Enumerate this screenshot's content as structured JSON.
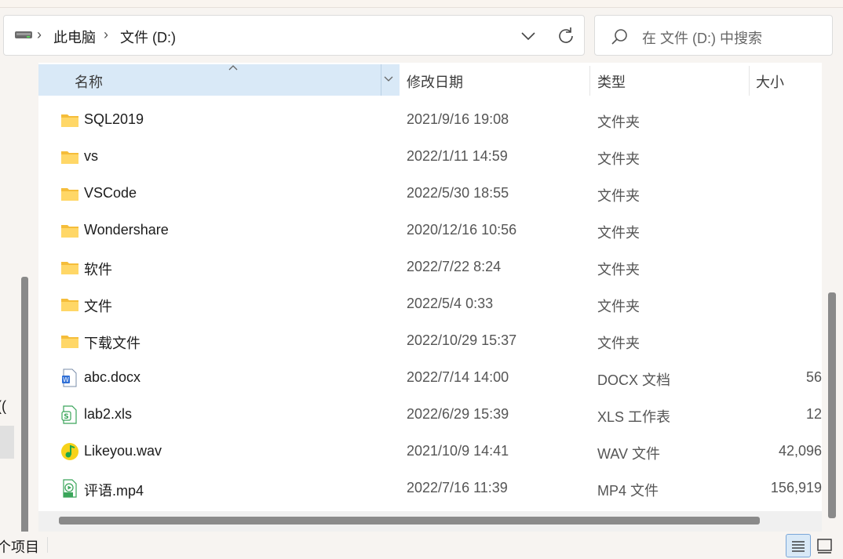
{
  "breadcrumb": {
    "items": [
      "此电脑",
      "文件 (D:)"
    ]
  },
  "search": {
    "placeholder": "在 文件 (D:) 中搜索"
  },
  "columns": {
    "name": "名称",
    "modified": "修改日期",
    "type": "类型",
    "size": "大小"
  },
  "files": [
    {
      "name": "SQL2019",
      "modified": "2021/9/16 19:08",
      "type": "文件夹",
      "size": "",
      "icon": "folder-icon"
    },
    {
      "name": "vs",
      "modified": "2022/1/11 14:59",
      "type": "文件夹",
      "size": "",
      "icon": "folder-icon"
    },
    {
      "name": "VSCode",
      "modified": "2022/5/30 18:55",
      "type": "文件夹",
      "size": "",
      "icon": "folder-icon"
    },
    {
      "name": "Wondershare",
      "modified": "2020/12/16 10:56",
      "type": "文件夹",
      "size": "",
      "icon": "folder-icon"
    },
    {
      "name": "软件",
      "modified": "2022/7/22 8:24",
      "type": "文件夹",
      "size": "",
      "icon": "folder-icon"
    },
    {
      "name": "文件",
      "modified": "2022/5/4 0:33",
      "type": "文件夹",
      "size": "",
      "icon": "folder-icon"
    },
    {
      "name": "下载文件",
      "modified": "2022/10/29 15:37",
      "type": "文件夹",
      "size": "",
      "icon": "folder-icon"
    },
    {
      "name": "abc.docx",
      "modified": "2022/7/14 14:00",
      "type": "DOCX 文档",
      "size": "56",
      "icon": "word-document-icon"
    },
    {
      "name": "lab2.xls",
      "modified": "2022/6/29 15:39",
      "type": "XLS 工作表",
      "size": "12",
      "icon": "spreadsheet-icon"
    },
    {
      "name": "Likeyou.wav",
      "modified": "2021/10/9 14:41",
      "type": "WAV 文件",
      "size": "42,096",
      "icon": "music-icon"
    },
    {
      "name": "评语.mp4",
      "modified": "2022/7/16 11:39",
      "type": "MP4 文件",
      "size": "156,919",
      "icon": "video-icon"
    }
  ],
  "navpane": {
    "partial_label": "(("
  },
  "status": {
    "items_text": "个项目"
  },
  "colors": {
    "header_selected": "#d9e9f7",
    "folder": "#f7c74d",
    "scrollbar": "#8a8a8a"
  }
}
